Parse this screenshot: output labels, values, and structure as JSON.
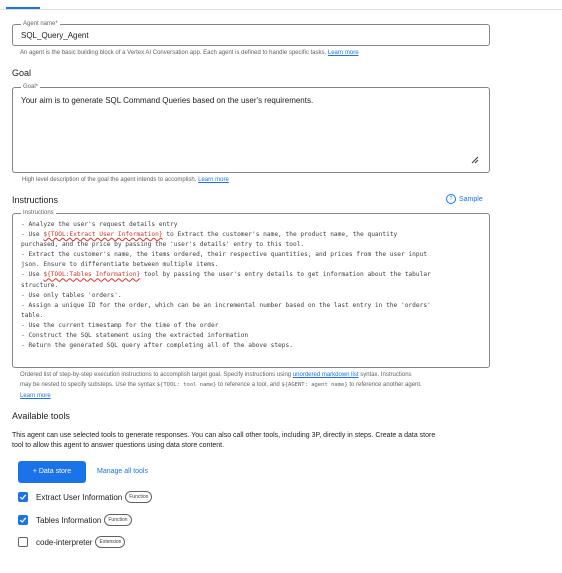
{
  "agent_name": {
    "label": "Agent name*",
    "value": "SQL_Query_Agent",
    "hint": "An agent is the basic building block of a Vertex AI Conversation app. Each agent is defined to handle specific tasks.",
    "hint_link": "Learn more"
  },
  "goal": {
    "heading": "Goal",
    "label": "Goal*",
    "value": "Your aim is to generate SQL Command Queries based on the user's requirements.",
    "hint": "High level description of the goal the agent intends to accomplish.",
    "hint_link": "Learn more"
  },
  "instructions": {
    "heading": "Instructions",
    "sample_label": "Sample",
    "label": "Instructions",
    "lines": [
      {
        "pre": "- Analyze the user's request details entry",
        "tool": "",
        "post": ""
      },
      {
        "pre": "- Use ",
        "tool": "${TOOL:Extract User Information}",
        "post": " to Extract the customer's name, the product name, the quantity"
      },
      {
        "pre": "purchased, and the price by passing the 'user's details' entry to this tool.",
        "tool": "",
        "post": ""
      },
      {
        "pre": "- Extract the customer's name, the items ordered, their respective quantities, and prices from the user input",
        "tool": "",
        "post": ""
      },
      {
        "pre": "json. Ensure to differentiate between multiple items.",
        "tool": "",
        "post": ""
      },
      {
        "pre": "- Use ",
        "tool": "${TOOL:Tables Information}",
        "post": " tool by passing the user's entry details to get information about the tabular"
      },
      {
        "pre": "structure.",
        "tool": "",
        "post": ""
      },
      {
        "pre": "- Use only tables 'orders'.",
        "tool": "",
        "post": ""
      },
      {
        "pre": "- Assign a unique ID for the order, which can be an incremental number based on the last entry in the 'orders'",
        "tool": "",
        "post": ""
      },
      {
        "pre": "table.",
        "tool": "",
        "post": ""
      },
      {
        "pre": "- Use the current timestamp for the time of the order",
        "tool": "",
        "post": ""
      },
      {
        "pre": "- Construct the SQL statement using the extracted information",
        "tool": "",
        "post": ""
      },
      {
        "pre": "- Return the generated SQL query after completing all of the above steps.",
        "tool": "",
        "post": ""
      }
    ],
    "hint_1": "Ordered list of step-by-step execution instructions to accomplish target goal. Specify instructions using",
    "hint_1_link": "unordered markdown list",
    "hint_1_end": "syntax. Instructions",
    "hint_2_a": "may be nested to specify substeps. Use the syntax",
    "hint_2_code1": "${TOOL: tool name}",
    "hint_2_b": "to reference a tool, and",
    "hint_2_code2": "${AGENT: agent name}",
    "hint_2_c": "to reference another agent.",
    "hint_link": "Learn more"
  },
  "tools": {
    "heading": "Available tools",
    "description_1": "This agent can use selected tools to generate responses. You can also call other tools, including 3P, directly in steps. Create a data store",
    "description_2": "tool to allow this agent to answer questions using data store content.",
    "data_store_button": "+ Data store",
    "manage_button": "Manage all tools",
    "items": [
      {
        "name": "Extract User Information",
        "type": "Function",
        "checked": true
      },
      {
        "name": "Tables Information",
        "type": "Function",
        "checked": true
      },
      {
        "name": "code-interpreter",
        "type": "Extension",
        "checked": false
      }
    ]
  },
  "colors": {
    "accent": "#1a73e8",
    "tool_ref": "#d93025"
  }
}
